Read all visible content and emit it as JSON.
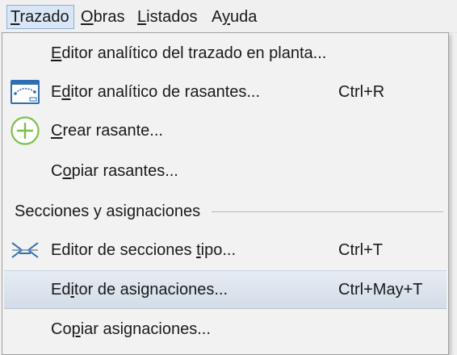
{
  "menubar": {
    "items": [
      {
        "pre": "",
        "key": "T",
        "post": "razado"
      },
      {
        "pre": "",
        "key": "O",
        "post": "bras"
      },
      {
        "pre": "",
        "key": "L",
        "post": "istados"
      },
      {
        "pre": "A",
        "key": "y",
        "post": "uda"
      }
    ]
  },
  "menu": {
    "items": [
      {
        "pre": "",
        "key": "E",
        "post": "ditor analítico del trazado en planta...",
        "shortcut": "",
        "icon": ""
      },
      {
        "pre": "E",
        "key": "d",
        "post": "itor analítico de rasantes...",
        "shortcut": "Ctrl+R",
        "icon": "grade-editor-icon"
      },
      {
        "pre": "",
        "key": "C",
        "post": "rear rasante...",
        "shortcut": "",
        "icon": "add-circle-icon"
      },
      {
        "pre": "C",
        "key": "o",
        "post": "piar rasantes...",
        "shortcut": "",
        "icon": ""
      },
      {
        "pre": "Editor de secciones ",
        "key": "t",
        "post": "ipo...",
        "shortcut": "Ctrl+T",
        "icon": "cross-section-icon"
      },
      {
        "pre": "Ed",
        "key": "i",
        "post": "tor de asignaciones...",
        "shortcut": "Ctrl+May+T",
        "icon": ""
      },
      {
        "pre": "Co",
        "key": "p",
        "post": "iar asignaciones...",
        "shortcut": "",
        "icon": ""
      }
    ],
    "section_header": "Secciones y asignaciones"
  },
  "colors": {
    "highlight": "#d9e0e9",
    "menubar_active": "#d9e6f5",
    "add_icon": "#7cc04a",
    "icon_blue": "#2d6fb0"
  }
}
